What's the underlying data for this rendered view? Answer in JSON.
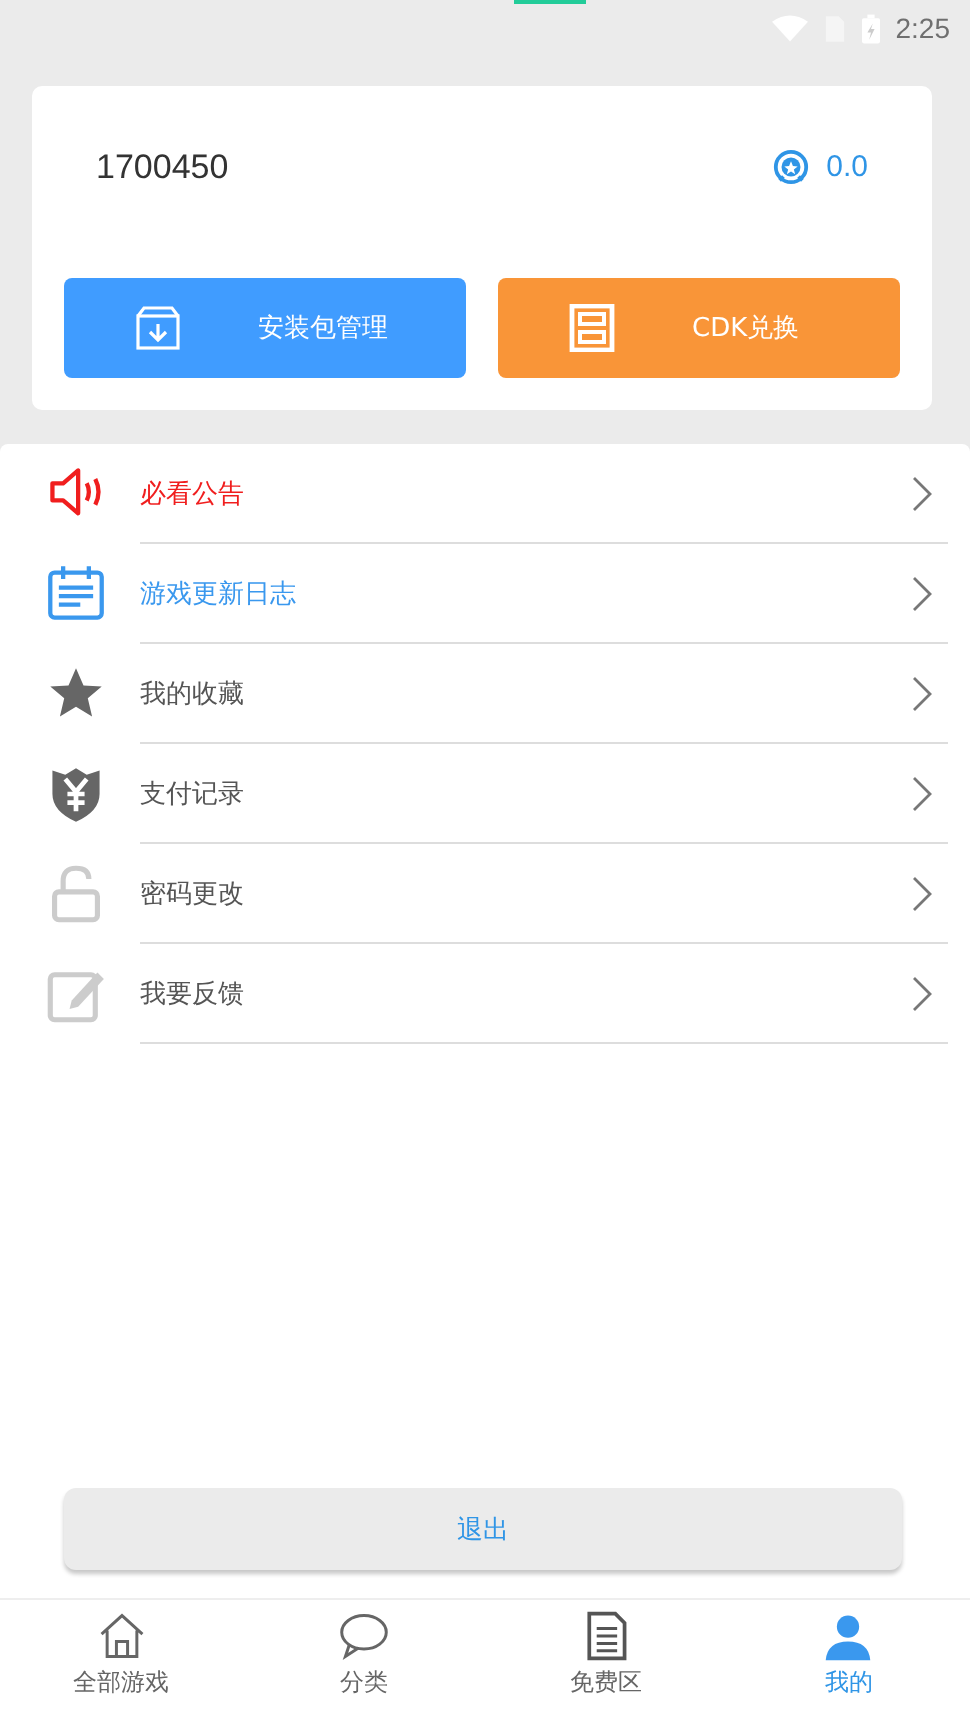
{
  "status_bar": {
    "time": "2:25"
  },
  "account": {
    "username": "1700450",
    "points": "0.0"
  },
  "actions": [
    {
      "kind": "package",
      "label": "安装包管理"
    },
    {
      "kind": "cdk",
      "label": "CDK兑换"
    }
  ],
  "menu": [
    {
      "kind": "announce",
      "label": "必看公告",
      "color": "#f01e1e"
    },
    {
      "kind": "changelog",
      "label": "游戏更新日志",
      "color": "#3a98ee"
    },
    {
      "kind": "favorites",
      "label": "我的收藏",
      "color": "#555555"
    },
    {
      "kind": "payments",
      "label": "支付记录",
      "color": "#555555"
    },
    {
      "kind": "password",
      "label": "密码更改",
      "color": "#555555"
    },
    {
      "kind": "feedback",
      "label": "我要反馈",
      "color": "#555555"
    }
  ],
  "logout": "退出",
  "tabs": [
    {
      "kind": "home",
      "label": "全部游戏",
      "selected": false
    },
    {
      "kind": "category",
      "label": "分类",
      "selected": false
    },
    {
      "kind": "free",
      "label": "免费区",
      "selected": false
    },
    {
      "kind": "me",
      "label": "我的",
      "selected": true
    }
  ]
}
